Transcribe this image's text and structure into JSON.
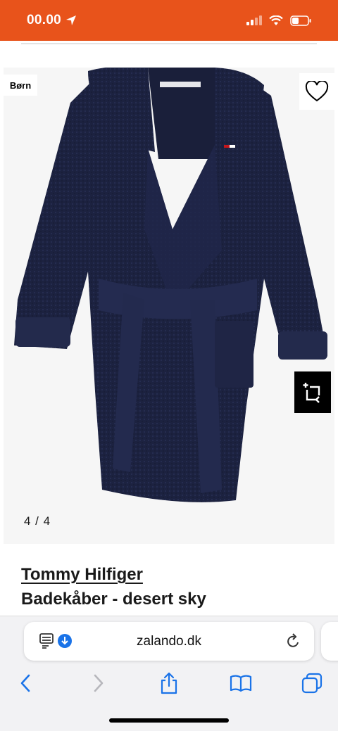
{
  "status_bar": {
    "time": "00.00",
    "accent": "#e8531b"
  },
  "product": {
    "badge": "Børn",
    "image_counter": "4 / 4",
    "brand": "Tommy Hilfiger",
    "name": "Badekåber - desert sky",
    "image_description_icon": "bathrobe-image"
  },
  "browser": {
    "url": "zalando.dk",
    "icons": [
      "reader-icon",
      "download-icon",
      "reload-icon",
      "back-icon",
      "forward-icon",
      "share-icon",
      "bookmarks-icon",
      "tabs-icon"
    ]
  }
}
